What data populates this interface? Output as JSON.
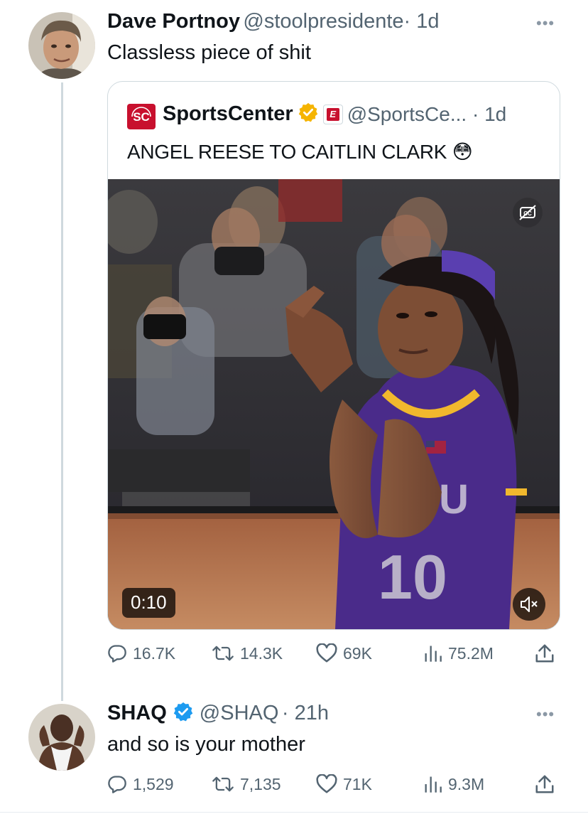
{
  "tweet1": {
    "name": "Dave Portnoy",
    "handle": "@stoolpresidente",
    "time": "· 1d",
    "text": "Classless piece of shit",
    "more": "•••",
    "quote": {
      "name": "SportsCenter",
      "badge_letter": "E",
      "handle": "@SportsCe... · 1d",
      "text": "ANGEL REESE TO CAITLIN CLARK 😳",
      "video_time": "0:10",
      "jersey_number": "10",
      "jersey_letters": "LSU"
    },
    "actions": {
      "replies": "16.7K",
      "reposts": "14.3K",
      "likes": "69K",
      "views": "75.2M"
    }
  },
  "tweet2": {
    "name": "SHAQ",
    "handle": "@SHAQ",
    "time": "· 21h",
    "text": "and so is your mother",
    "more": "•••",
    "actions": {
      "replies": "1,529",
      "reposts": "7,135",
      "likes": "71K",
      "views": "9.3M"
    }
  },
  "colors": {
    "verified_gold": "#f5b400",
    "verified_blue": "#1d9bf0",
    "espn_red": "#c8102e",
    "lsu_purple": "#4a2b8a",
    "lsu_gold": "#f1b82d"
  }
}
